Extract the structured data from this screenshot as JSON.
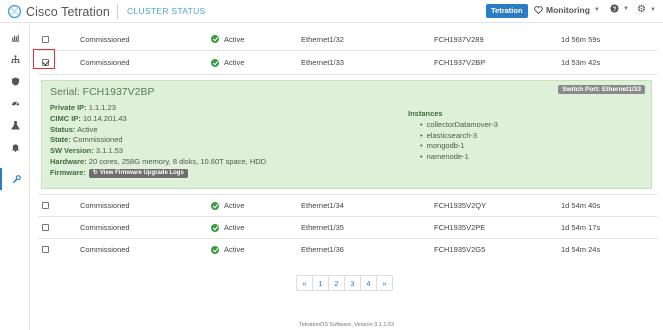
{
  "header": {
    "logo_text": "Cisco Tetration",
    "page_title": "CLUSTER STATUS",
    "scope_button": "Tetration",
    "monitoring_label": "Monitoring",
    "help_label": "?",
    "settings_label": ""
  },
  "sidebar": {
    "items": [
      {
        "icon": "bar-chart-icon"
      },
      {
        "icon": "hierarchy-icon"
      },
      {
        "icon": "shield-icon"
      },
      {
        "icon": "dashboard-icon"
      },
      {
        "icon": "flask-icon"
      },
      {
        "icon": "bell-icon"
      },
      {
        "icon": "wrench-icon",
        "active": true
      }
    ]
  },
  "rows_before": [
    {
      "state": "Commissioned",
      "status": "Active",
      "port": "Ethernet1/32",
      "serial": "FCH1937V289",
      "uptime": "1d 56m 59s"
    },
    {
      "state": "Commissioned",
      "status": "Active",
      "port": "Ethernet1/33",
      "serial": "FCH1937V2BP",
      "uptime": "1d 53m 42s"
    }
  ],
  "detail": {
    "serial": "Serial: FCH1937V2BP",
    "switch_port": "Switch Port: Ethernet1/33",
    "private_ip_label": "Private IP:",
    "private_ip": "1.1.1.23",
    "cimc_ip_label": "CIMC IP:",
    "cimc_ip": "10.14.201.43",
    "status_label": "Status:",
    "status": "Active",
    "state_label": "State:",
    "state": "Commissioned",
    "sw_version_label": "SW Version:",
    "sw_version": "3.1.1.53",
    "hardware_label": "Hardware:",
    "hardware": "20 cores, 258G memory, 8 disks, 10.60T space, HDD",
    "firmware_label": "Firmware:",
    "firmware_button": "View Firmware Upgrade Logs",
    "instances_title": "Instances",
    "instances": [
      "collectorDatamover-3",
      "elasticsearch-3",
      "mongodb-1",
      "namenode-1"
    ]
  },
  "rows_after": [
    {
      "state": "Commissioned",
      "status": "Active",
      "port": "Ethernet1/34",
      "serial": "FCH1935V2QY",
      "uptime": "1d 54m 40s"
    },
    {
      "state": "Commissioned",
      "status": "Active",
      "port": "Ethernet1/35",
      "serial": "FCH1935V2PE",
      "uptime": "1d 54m 17s"
    },
    {
      "state": "Commissioned",
      "status": "Active",
      "port": "Ethernet1/36",
      "serial": "FCH1935V2G5",
      "uptime": "1d 54m 24s"
    }
  ],
  "pagination": [
    "«",
    "1",
    "2",
    "3",
    "4",
    "»"
  ],
  "footer": "TetrationOS Software, Version 3.1.1.53",
  "colors": {
    "accent": "#2a7dc2",
    "active_green": "#3a9a45",
    "panel_green": "#dff0d8",
    "selection_red": "#e03030"
  }
}
